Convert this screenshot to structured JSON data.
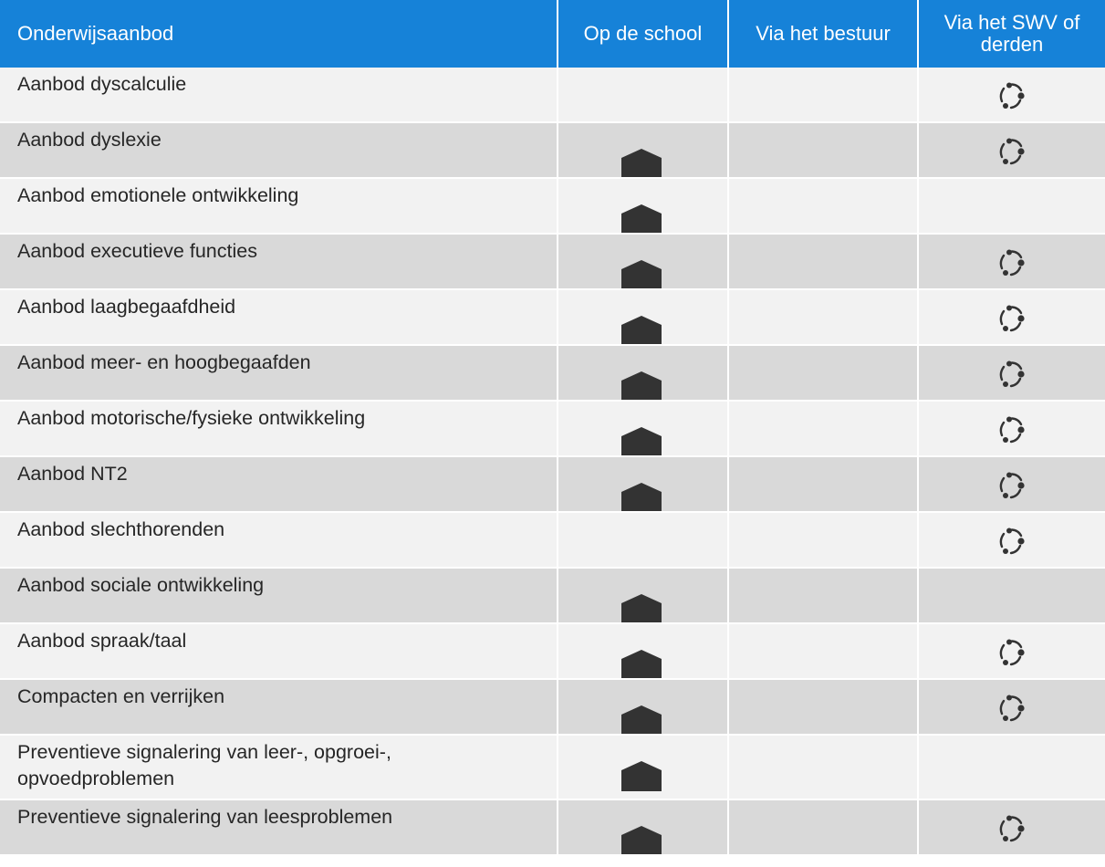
{
  "header": {
    "col_offer": "Onderwijsaanbod",
    "col_school": "Op de school",
    "col_board": "Via het bestuur",
    "col_swv": "Via het SWV of derden"
  },
  "legend_icons": {
    "school": "house-icon",
    "swv": "cycle-icon"
  },
  "rows": [
    {
      "label": "Aanbod dyscalculie",
      "school": false,
      "board": false,
      "swv": true
    },
    {
      "label": "Aanbod dyslexie",
      "school": true,
      "board": false,
      "swv": true
    },
    {
      "label": "Aanbod emotionele ontwikkeling",
      "school": true,
      "board": false,
      "swv": false
    },
    {
      "label": "Aanbod executieve functies",
      "school": true,
      "board": false,
      "swv": true
    },
    {
      "label": "Aanbod laagbegaafdheid",
      "school": true,
      "board": false,
      "swv": true
    },
    {
      "label": "Aanbod meer- en hoogbegaafden",
      "school": true,
      "board": false,
      "swv": true
    },
    {
      "label": "Aanbod motorische/fysieke ontwikkeling",
      "school": true,
      "board": false,
      "swv": true
    },
    {
      "label": "Aanbod NT2",
      "school": true,
      "board": false,
      "swv": true
    },
    {
      "label": "Aanbod slechthorenden",
      "school": false,
      "board": false,
      "swv": true
    },
    {
      "label": "Aanbod sociale ontwikkeling",
      "school": true,
      "board": false,
      "swv": false
    },
    {
      "label": "Aanbod spraak/taal",
      "school": true,
      "board": false,
      "swv": true
    },
    {
      "label": "Compacten en verrijken",
      "school": true,
      "board": false,
      "swv": true
    },
    {
      "label": "Preventieve signalering van leer-, opgroei-, opvoedproblemen",
      "school": true,
      "board": false,
      "swv": false
    },
    {
      "label": "Preventieve signalering van leesproblemen",
      "school": true,
      "board": false,
      "swv": true
    }
  ],
  "colors": {
    "header_bg": "#1682d8",
    "row_light": "#f2f2f2",
    "row_dark": "#d9d9d9",
    "icon": "#333333"
  }
}
